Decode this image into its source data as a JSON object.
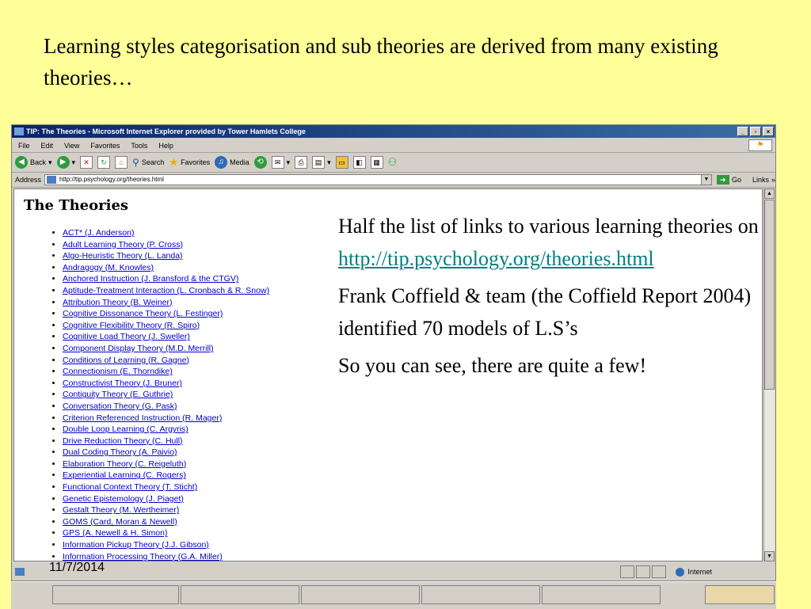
{
  "slide": {
    "title": "Learning styles categorisation and sub theories are derived from many existing theories…",
    "date": "11/7/2014",
    "callout": {
      "line1": "Half the list of links to various learning theories on",
      "link": "http://tip.psychology.org/theories.html",
      "para2": "Frank Coffield & team (the Coffield Report 2004) identified 70 models of L.S’s",
      "para3": "So you can see, there are quite a few!"
    }
  },
  "browser": {
    "title": "TIP: The Theories - Microsoft Internet Explorer provided by Tower Hamlets College",
    "window_buttons": {
      "minimize": "_",
      "maximize": "▫",
      "close": "×"
    },
    "menu": [
      "File",
      "Edit",
      "View",
      "Favorites",
      "Tools",
      "Help"
    ],
    "toolbar": {
      "back": "Back",
      "search": "Search",
      "favorites": "Favorites",
      "media": "Media"
    },
    "address_label": "Address",
    "address_url": "http://tip.psychology.org/theories.html",
    "go_label": "Go",
    "links_label": "Links",
    "status_zone": "Internet"
  },
  "page": {
    "heading": "The Theories",
    "theories": [
      "ACT* (J. Anderson)",
      "Adult Learning Theory (P. Cross)",
      "Algo-Heuristic Theory (L. Landa)",
      "Andragogy (M. Knowles)",
      "Anchored Instruction (J. Bransford & the CTGV)",
      "Aptitude-Treatment Interaction (L. Cronbach & R. Snow)",
      "Attribution Theory (B. Weiner)",
      "Cognitive Dissonance Theory (L. Festinger)",
      "Cognitive Flexibility Theory (R. Spiro)",
      "Cognitive Load Theory (J. Sweller)",
      "Component Display Theory (M.D. Merrill)",
      "Conditions of Learning (R. Gagne)",
      "Connectionism (E. Thorndike)",
      "Constructivist Theory (J. Bruner)",
      "Contiguity Theory (E. Guthrie)",
      "Conversation Theory (G. Pask)",
      "Criterion Referenced Instruction (R. Mager)",
      "Double Loop Learning (C. Argyris)",
      "Drive Reduction Theory (C. Hull)",
      "Dual Coding Theory (A. Paivio)",
      "Elaboration Theory (C. Reigeluth)",
      "Experiential Learning (C. Rogers)",
      "Functional Context Theory (T. Sticht)",
      "Genetic Epistemology (J. Piaget)",
      "Gestalt Theory (M. Wertheimer)",
      "GOMS (Card, Moran & Newell)",
      "GPS (A. Newell & H. Simon)",
      "Information Pickup Theory (J.J. Gibson)",
      "Information Processing Theory (G.A. Miller)"
    ]
  }
}
